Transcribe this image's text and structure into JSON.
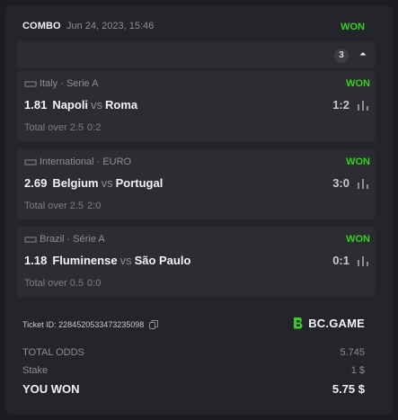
{
  "header": {
    "title": "COMBO",
    "date": "Jun 24, 2023, 15:46",
    "status": "WON"
  },
  "toggle": {
    "count": "3"
  },
  "bets": [
    {
      "league": "Italy · Serie A",
      "status": "WON",
      "odd": "1.81",
      "home": "Napoli",
      "vs": "vs",
      "away": "Roma",
      "score": "1:2",
      "market": "Total over 2.5",
      "market_result": "0:2"
    },
    {
      "league": "International · EURO",
      "status": "WON",
      "odd": "2.69",
      "home": "Belgium",
      "vs": "vs",
      "away": "Portugal",
      "score": "3:0",
      "market": "Total over 2.5",
      "market_result": "2:0"
    },
    {
      "league": "Brazil · Série A",
      "status": "WON",
      "odd": "1.18",
      "home": "Fluminense",
      "vs": "vs",
      "away": "São Paulo",
      "score": "0:1",
      "market": "Total over 0.5",
      "market_result": "0:0"
    }
  ],
  "ticket": {
    "label": "Ticket ID: 2284520533473235098"
  },
  "brand": {
    "name": "BC.GAME"
  },
  "summary": {
    "total_odds_label": "TOTAL ODDS",
    "total_odds_value": "5.745",
    "stake_label": "Stake",
    "stake_value": "1 $",
    "won_label": "YOU WON",
    "won_value": "5.75 $"
  },
  "colors": {
    "win": "#37d020",
    "card": "#24252a",
    "row": "#2c2d32"
  }
}
